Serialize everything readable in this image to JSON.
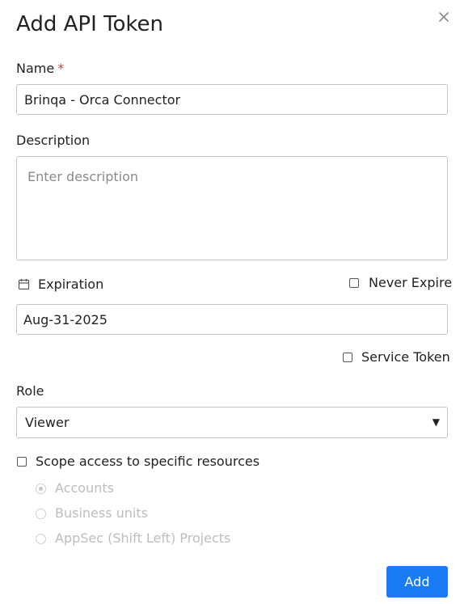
{
  "dialog": {
    "title": "Add API Token"
  },
  "name": {
    "label": "Name",
    "required_marker": "*",
    "value": "Brinqa - Orca Connector"
  },
  "description": {
    "label": "Description",
    "placeholder": "Enter description",
    "value": ""
  },
  "expiration": {
    "label": "Expiration",
    "icon": "calendar-icon",
    "value": "Aug-31-2025",
    "never_expire_label": "Never Expire",
    "never_expire_checked": false
  },
  "service_token": {
    "label": "Service Token",
    "checked": false
  },
  "role": {
    "label": "Role",
    "selected": "Viewer",
    "caret": "▼"
  },
  "scope": {
    "label": "Scope access to specific resources",
    "checked": false,
    "options": [
      {
        "label": "Accounts",
        "selected": true
      },
      {
        "label": "Business units",
        "selected": false
      },
      {
        "label": "AppSec (Shift Left) Projects",
        "selected": false
      }
    ]
  },
  "actions": {
    "add_label": "Add"
  },
  "colors": {
    "primary": "#1a7cf5",
    "required": "#d9363e",
    "disabled_text": "#bdbdbd"
  }
}
